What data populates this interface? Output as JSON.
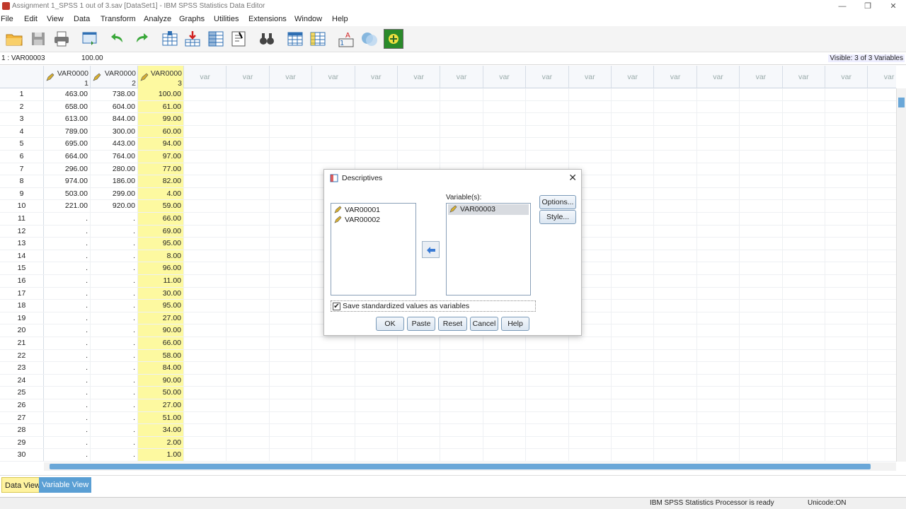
{
  "window": {
    "title": "Assignment 1_SPSS 1 out of 3.sav [DataSet1] - IBM SPSS Statistics Data Editor"
  },
  "menu": [
    "File",
    "Edit",
    "View",
    "Data",
    "Transform",
    "Analyze",
    "Graphs",
    "Utilities",
    "Extensions",
    "Window",
    "Help"
  ],
  "toolbar_icons": [
    "open-folder-icon",
    "save-icon",
    "print-icon",
    "dialog-recall-icon",
    "undo-icon",
    "redo-icon",
    "goto-case-icon",
    "goto-variable-icon",
    "variables-icon",
    "run-descriptives-icon",
    "find-icon",
    "insert-cases-icon",
    "insert-variable-icon",
    "value-labels-icon",
    "use-variable-sets-icon",
    "add-on-icon"
  ],
  "cellbar": {
    "ref": "1 : VAR00003",
    "value": "100.00",
    "visible": "Visible: 3 of 3 Variables"
  },
  "columns": [
    {
      "line1": "VAR0000",
      "line2": "1"
    },
    {
      "line1": "VAR0000",
      "line2": "2"
    },
    {
      "line1": "VAR0000",
      "line2": "3"
    }
  ],
  "empty_col_label": "var",
  "rows": [
    [
      "1",
      "463.00",
      "738.00",
      "100.00"
    ],
    [
      "2",
      "658.00",
      "604.00",
      "61.00"
    ],
    [
      "3",
      "613.00",
      "844.00",
      "99.00"
    ],
    [
      "4",
      "789.00",
      "300.00",
      "60.00"
    ],
    [
      "5",
      "695.00",
      "443.00",
      "94.00"
    ],
    [
      "6",
      "664.00",
      "764.00",
      "97.00"
    ],
    [
      "7",
      "296.00",
      "280.00",
      "77.00"
    ],
    [
      "8",
      "974.00",
      "186.00",
      "82.00"
    ],
    [
      "9",
      "503.00",
      "299.00",
      "4.00"
    ],
    [
      "10",
      "221.00",
      "920.00",
      "59.00"
    ],
    [
      "11",
      ".",
      ".",
      "66.00"
    ],
    [
      "12",
      ".",
      ".",
      "69.00"
    ],
    [
      "13",
      ".",
      ".",
      "95.00"
    ],
    [
      "14",
      ".",
      ".",
      "8.00"
    ],
    [
      "15",
      ".",
      ".",
      "96.00"
    ],
    [
      "16",
      ".",
      ".",
      "11.00"
    ],
    [
      "17",
      ".",
      ".",
      "30.00"
    ],
    [
      "18",
      ".",
      ".",
      "95.00"
    ],
    [
      "19",
      ".",
      ".",
      "27.00"
    ],
    [
      "20",
      ".",
      ".",
      "90.00"
    ],
    [
      "21",
      ".",
      ".",
      "66.00"
    ],
    [
      "22",
      ".",
      ".",
      "58.00"
    ],
    [
      "23",
      ".",
      ".",
      "84.00"
    ],
    [
      "24",
      ".",
      ".",
      "90.00"
    ],
    [
      "25",
      ".",
      ".",
      "50.00"
    ],
    [
      "26",
      ".",
      ".",
      "27.00"
    ],
    [
      "27",
      ".",
      ".",
      "51.00"
    ],
    [
      "28",
      ".",
      ".",
      "34.00"
    ],
    [
      "29",
      ".",
      ".",
      "2.00"
    ],
    [
      "30",
      ".",
      ".",
      "1.00"
    ]
  ],
  "tabs": {
    "data_view": "Data View",
    "variable_view": "Variable View"
  },
  "status": {
    "processor": "IBM SPSS Statistics Processor is ready",
    "unicode": "Unicode:ON"
  },
  "dialog": {
    "title": "Descriptives",
    "source_vars": [
      "VAR00001",
      "VAR00002"
    ],
    "variables_label": "Variable(s):",
    "selected_vars": [
      "VAR00003"
    ],
    "options_label": "Options...",
    "style_label": "Style...",
    "checkbox_label": "Save standardized values as variables",
    "checkbox_checked": true,
    "ok_label": "OK",
    "paste_label": "Paste",
    "reset_label": "Reset",
    "cancel_label": "Cancel",
    "help_label": "Help"
  }
}
